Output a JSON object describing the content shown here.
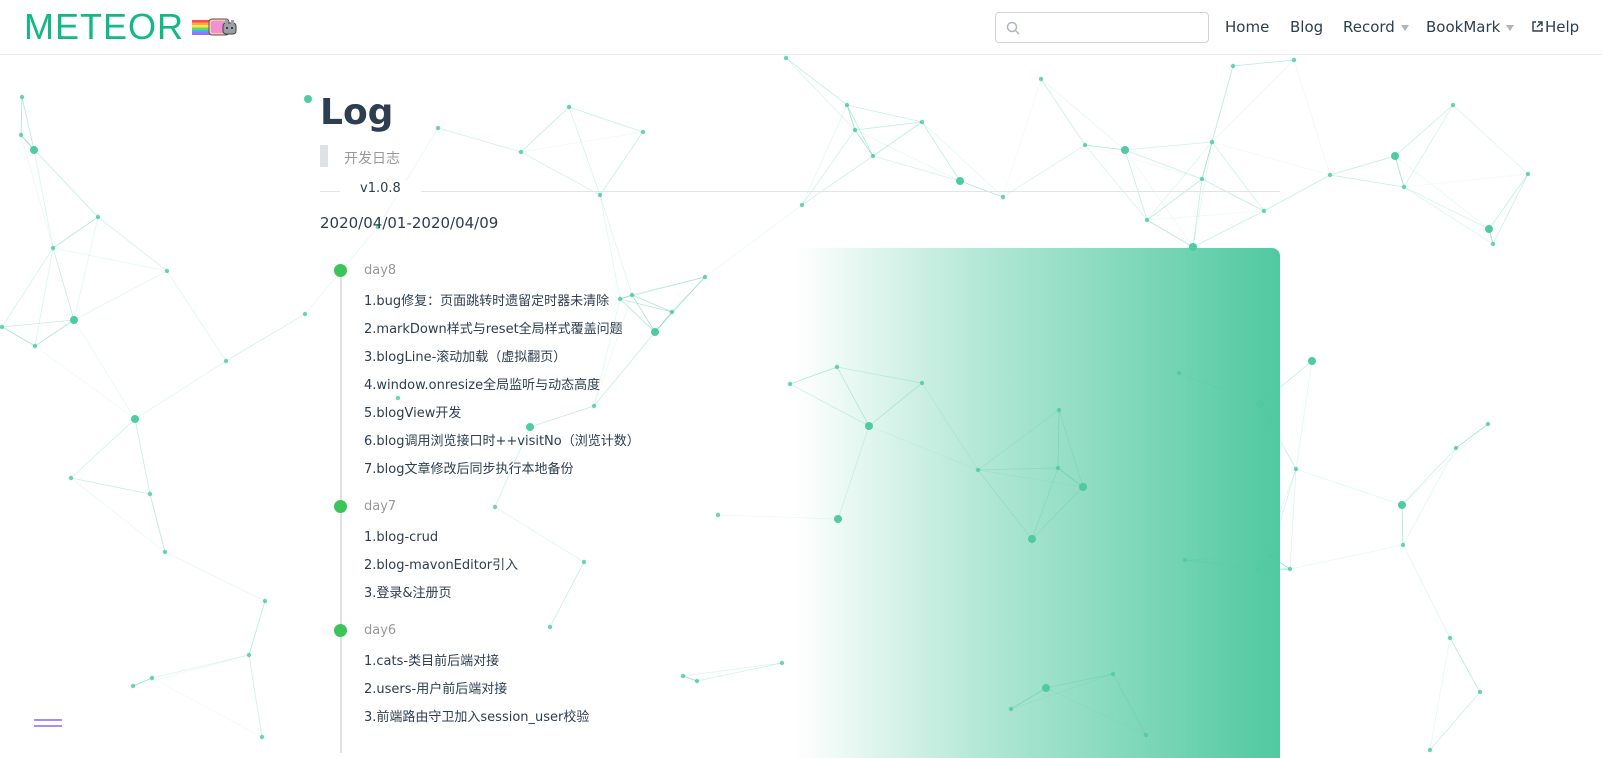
{
  "brand": {
    "logo_text": "METEOR",
    "accent": "#12b886"
  },
  "search": {
    "placeholder": "",
    "value": ""
  },
  "nav": {
    "items": [
      {
        "label": "Home",
        "dropdown": false
      },
      {
        "label": "Blog",
        "dropdown": false
      },
      {
        "label": "Record",
        "dropdown": true
      },
      {
        "label": "BookMark",
        "dropdown": true
      },
      {
        "label": "Help",
        "icon": "external-link-icon"
      }
    ]
  },
  "page": {
    "title": "Log",
    "subtitle": "开发日志",
    "version": "v1.0.8",
    "date_range": "2020/04/01-2020/04/09"
  },
  "timeline": [
    {
      "day": "day8",
      "entries": [
        "1.bug修复：页面跳转时遗留定时器未清除",
        "2.markDown样式与reset全局样式覆盖问题",
        "3.blogLine-滚动加载（虚拟翻页）",
        "4.window.onresize全局监听与动态高度",
        "5.blogView开发",
        "6.blog调用浏览接口时++visitNo（浏览计数）",
        "7.blog文章修改后同步执行本地备份"
      ]
    },
    {
      "day": "day7",
      "entries": [
        "1.blog-crud",
        "2.blog-mavonEditor引入",
        "3.登录&注册页"
      ]
    },
    {
      "day": "day6",
      "entries": [
        "1.cats-类目前后端对接",
        "2.users-用户前后端对接",
        "3.前端路由守卫加入session_user校验"
      ]
    }
  ],
  "colors": {
    "timeline_dot": "#3bc45a",
    "panel_gradient": "#50c9a0",
    "menu_toggle": "#a78bfa",
    "network": "#3cc79a"
  }
}
